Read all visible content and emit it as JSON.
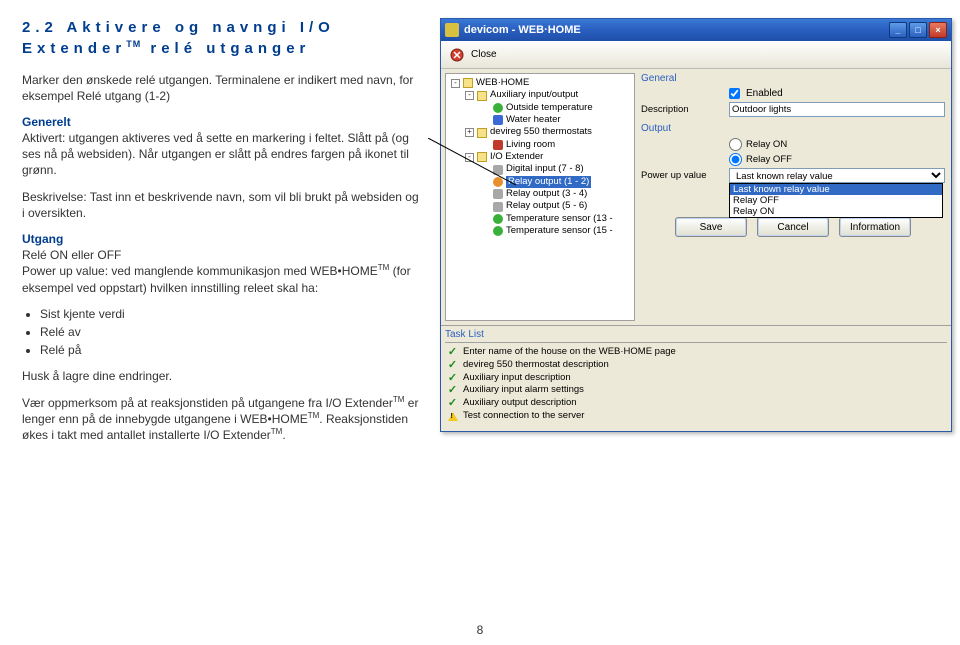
{
  "section_header_pre": "2.2 Aktivere og navngi I/O Extender",
  "section_header_sup": "TM",
  "section_header_post": " relé utganger",
  "left": {
    "p1": "Marker den ønskede relé utgangen. Terminalene er indikert med navn, for eksempel Relé utgang (1-2)",
    "generelt_head": "Generelt",
    "generelt_body": "Aktivert: utgangen aktiveres ved å sette en markering i feltet. Slått på (og ses nå på websiden). Når utgangen er slått på endres fargen på ikonet til grønn.",
    "besk": "Beskrivelse: Tast inn et beskrivende navn, som vil bli brukt på websiden og i oversikten.",
    "utgang_head": "Utgang",
    "utgang_body1": "Relé ON eller OFF",
    "utgang_body2_a": "Power up value: ved manglende kommunikasjon med WEB•HOME",
    "utgang_body2_b": " (for eksempel ved oppstart) hvilken innstilling releet skal ha:",
    "bullets": [
      "Sist kjente verdi",
      "Relé av",
      "Relé på"
    ],
    "husk": "Husk å lagre dine endringer.",
    "note_a": "Vær oppmerksom på at reaksjonstiden på utgangene fra I/O Extender",
    "note_b": " er lenger enn på de innebygde utgangene i WEB•HOME",
    "note_c": ". Reaksjonstiden økes i takt med antallet installerte I/O Extender",
    "note_d": "."
  },
  "app": {
    "title": "devicom - WEB·HOME",
    "toolbar_close": "Close",
    "tree": [
      {
        "indent": 0,
        "exp": "-",
        "icon": "ico-folder",
        "label": "WEB·HOME"
      },
      {
        "indent": 1,
        "exp": "-",
        "icon": "ico-folder",
        "label": "Auxiliary input/output"
      },
      {
        "indent": 2,
        "exp": "",
        "icon": "ico-green",
        "label": "Outside temperature"
      },
      {
        "indent": 2,
        "exp": "",
        "icon": "ico-blue",
        "label": "Water heater"
      },
      {
        "indent": 1,
        "exp": "+",
        "icon": "ico-folder",
        "label": "devireg 550 thermostats"
      },
      {
        "indent": 2,
        "exp": "",
        "icon": "ico-red",
        "label": "Living room"
      },
      {
        "indent": 1,
        "exp": "-",
        "icon": "ico-folder",
        "label": "I/O Extender"
      },
      {
        "indent": 2,
        "exp": "",
        "icon": "ico-gray",
        "label": "Digital input (7 - 8)"
      },
      {
        "indent": 2,
        "exp": "",
        "icon": "ico-orange",
        "label": "Relay output (1 - 2)",
        "selected": true
      },
      {
        "indent": 2,
        "exp": "",
        "icon": "ico-gray",
        "label": "Relay output (3 - 4)"
      },
      {
        "indent": 2,
        "exp": "",
        "icon": "ico-gray",
        "label": "Relay output (5 - 6)"
      },
      {
        "indent": 2,
        "exp": "",
        "icon": "ico-green",
        "label": "Temperature sensor (13 -"
      },
      {
        "indent": 2,
        "exp": "",
        "icon": "ico-green",
        "label": "Temperature sensor (15 -"
      }
    ],
    "form": {
      "general_title": "General",
      "enabled_label": "Enabled",
      "desc_label": "Description",
      "desc_value": "Outdoor lights",
      "output_title": "Output",
      "relay_on": "Relay ON",
      "relay_off": "Relay OFF",
      "powerup_label": "Power up value",
      "powerup_value": "Last known relay value",
      "powerup_options": [
        "Last known relay value",
        "Relay OFF",
        "Relay ON"
      ]
    },
    "buttons": {
      "save": "Save",
      "cancel": "Cancel",
      "info": "Information"
    },
    "task_header": "Task List",
    "tasks": [
      {
        "icon": "tick",
        "label": "Enter name of the house on the WEB·HOME page"
      },
      {
        "icon": "tick",
        "label": "devireg 550 thermostat description"
      },
      {
        "icon": "tick",
        "label": "Auxiliary input description"
      },
      {
        "icon": "tick",
        "label": "Auxiliary input alarm settings"
      },
      {
        "icon": "tick",
        "label": "Auxiliary output description"
      },
      {
        "icon": "warn",
        "label": "Test connection to the server"
      }
    ]
  },
  "page_number": "8"
}
